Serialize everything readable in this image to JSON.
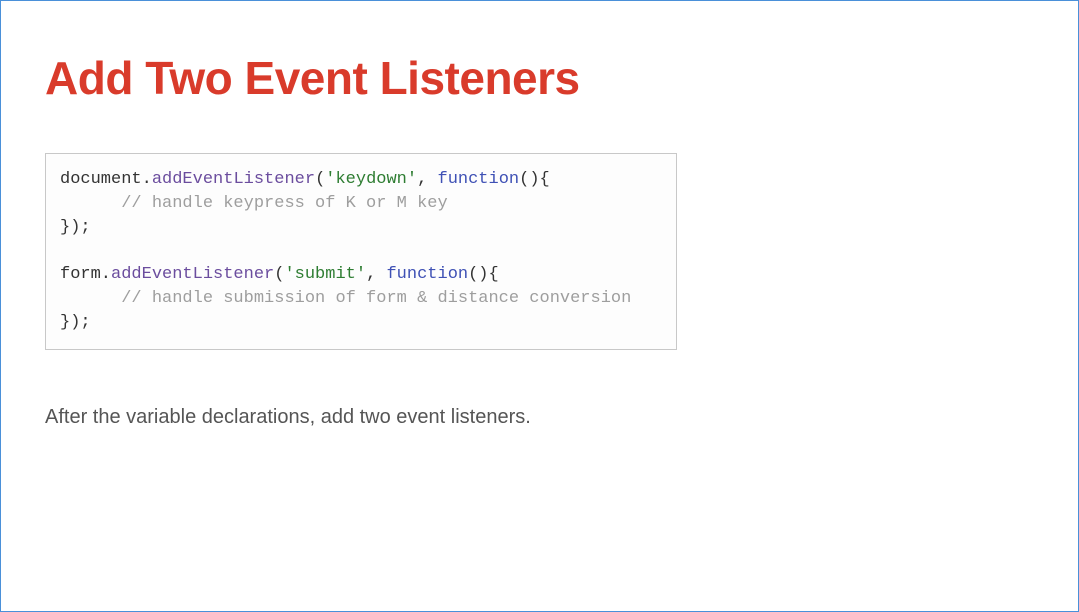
{
  "heading": "Add Two Event Listeners",
  "code": {
    "l1_obj": "document.",
    "l1_method": "addEventListener",
    "l1_open": "(",
    "l1_str": "'keydown'",
    "l1_mid": ", ",
    "l1_func": "function",
    "l1_rest": "(){",
    "l2_indent": "      ",
    "l2_comment": "// handle keypress of K or M key",
    "l3": "});",
    "blank": "",
    "l4_obj": "form.",
    "l4_method": "addEventListener",
    "l4_open": "(",
    "l4_str": "'submit'",
    "l4_mid": ", ",
    "l4_func": "function",
    "l4_rest": "(){",
    "l5_indent": "      ",
    "l5_comment": "// handle submission of form & distance conversion",
    "l6": "});"
  },
  "caption": "After the variable declarations, add two event listeners."
}
